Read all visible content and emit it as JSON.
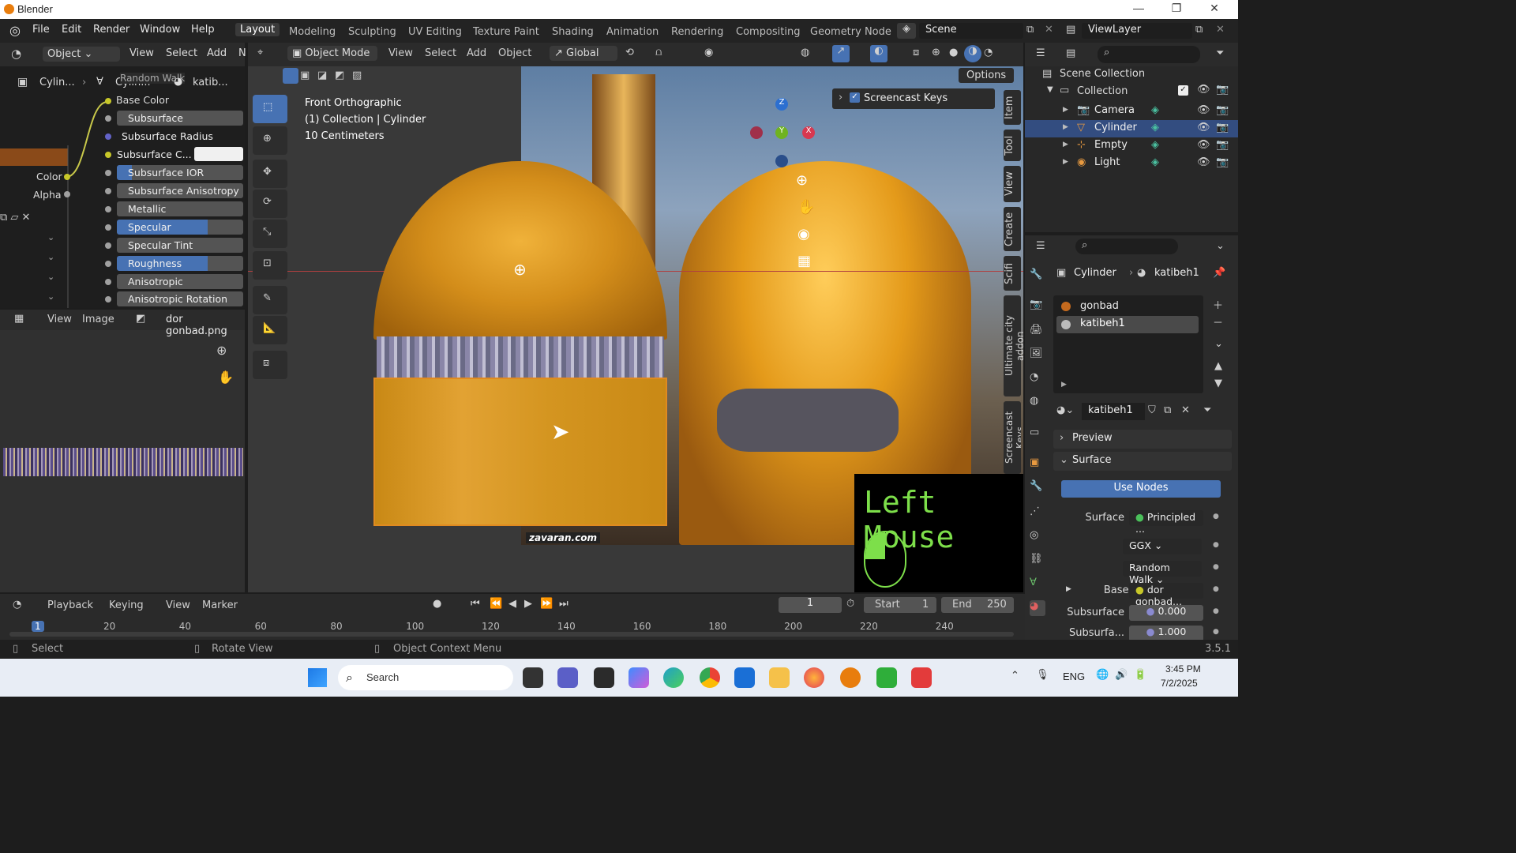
{
  "window": {
    "title": "Blender",
    "minimize": "—",
    "maximize": "❐",
    "close": "✕"
  },
  "menu": [
    "File",
    "Edit",
    "Render",
    "Window",
    "Help"
  ],
  "workspaces": [
    "Layout",
    "Modeling",
    "Sculpting",
    "UV Editing",
    "Texture Paint",
    "Shading",
    "Animation",
    "Rendering",
    "Compositing",
    "Geometry Node"
  ],
  "scene": "Scene",
  "view_layer": "ViewLayer",
  "left_header": {
    "mode": "Object",
    "items": [
      "View",
      "Select",
      "Add",
      "N"
    ]
  },
  "node_editor": {
    "breadcrumb": [
      "Cylin...",
      "Cylin...",
      "katib..."
    ],
    "overlay_label": "Random Walk",
    "base_color": "Base Color",
    "node_out": [
      "Color",
      "Alpha"
    ],
    "fields": [
      {
        "label": "Subsurface",
        "fill": 0
      },
      {
        "label": "Subsurface Radius",
        "fill": 0
      },
      {
        "label": "Subsurface C...",
        "fill": 0
      },
      {
        "label": "Subsurface IOR",
        "fill": 0.12
      },
      {
        "label": "Subsurface Anisotropy",
        "fill": 0
      },
      {
        "label": "Metallic",
        "fill": 0
      },
      {
        "label": "Specular",
        "fill": 0.72
      },
      {
        "label": "Specular Tint",
        "fill": 0
      },
      {
        "label": "Roughness",
        "fill": 0.72
      },
      {
        "label": "Anisotropic",
        "fill": 0
      },
      {
        "label": "Anisotropic Rotation",
        "fill": 0
      }
    ]
  },
  "image_editor": {
    "view": "View",
    "image": "Image",
    "file": "dor gonbad.png"
  },
  "viewport": {
    "mode": "Object Mode",
    "menus": [
      "View",
      "Select",
      "Add",
      "Object"
    ],
    "orientation": "Global",
    "options": "Options",
    "info": [
      "Front Orthographic",
      "(1) Collection | Cylinder",
      "10 Centimeters"
    ],
    "watermark": "zavaran.com",
    "screencast_panel": "Screencast Keys",
    "key_display": "Left Mouse",
    "gizmo": {
      "z": "Z",
      "y": "Y",
      "x": "X"
    },
    "side_tabs": [
      "Item",
      "Tool",
      "View",
      "Create",
      "Scifi",
      "Ultimate city addon",
      "Screencast Keys"
    ]
  },
  "outliner": {
    "root": "Scene Collection",
    "collection": "Collection",
    "items": [
      "Camera",
      "Cylinder",
      "Empty",
      "Light"
    ],
    "selected": "Cylinder"
  },
  "properties": {
    "breadcrumb": [
      "Cylinder",
      "katibeh1"
    ],
    "materials": [
      "gonbad",
      "katibeh1"
    ],
    "active_material": "katibeh1",
    "preview": "Preview",
    "surface_section": "Surface",
    "use_nodes": "Use Nodes",
    "rows": [
      {
        "label": "Surface",
        "value": "Principled ..."
      },
      {
        "label": "",
        "value": "GGX"
      },
      {
        "label": "",
        "value": "Random Walk"
      },
      {
        "label": "Base ...",
        "value": "dor gonbad..."
      },
      {
        "label": "Subsurface",
        "value": "0.000"
      },
      {
        "label": "Subsurfa...",
        "value": "1.000"
      }
    ]
  },
  "timeline": {
    "menus": [
      "Playback",
      "Keying",
      "View",
      "Marker"
    ],
    "current": "1",
    "start_label": "Start",
    "start": "1",
    "end_label": "End",
    "end": "250",
    "ticks": [
      "1",
      "20",
      "40",
      "60",
      "80",
      "100",
      "120",
      "140",
      "160",
      "180",
      "200",
      "220",
      "240"
    ]
  },
  "statusbar": {
    "left": "Select",
    "mid": "Rotate View",
    "right": "Object Context Menu",
    "version": "3.5.1"
  },
  "taskbar": {
    "search": "Search",
    "lang": "ENG",
    "time": "3:45 PM",
    "date": "7/2/2025"
  }
}
